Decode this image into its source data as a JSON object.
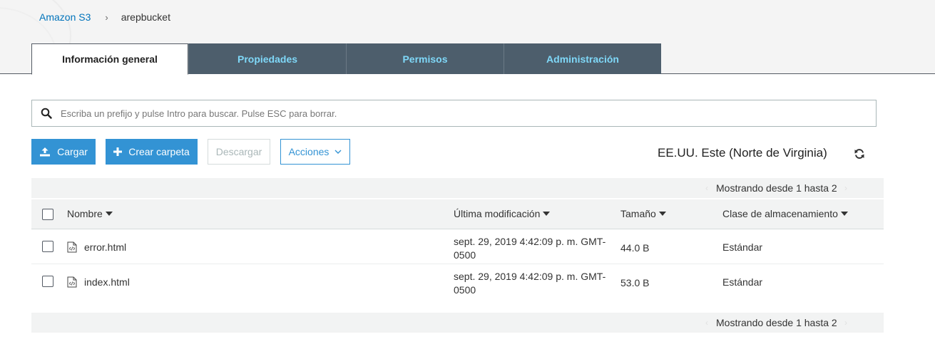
{
  "breadcrumb": {
    "root": "Amazon S3",
    "separator": "›",
    "current": "arepbucket"
  },
  "tabs": [
    {
      "label": "Información general",
      "active": true
    },
    {
      "label": "Propiedades",
      "active": false
    },
    {
      "label": "Permisos",
      "active": false
    },
    {
      "label": "Administración",
      "active": false
    }
  ],
  "search": {
    "placeholder": "Escriba un prefijo y pulse Intro para buscar. Pulse ESC para borrar.",
    "value": ""
  },
  "toolbar": {
    "upload": "Cargar",
    "create_folder": "Crear carpeta",
    "download": "Descargar",
    "actions": "Acciones"
  },
  "region": "EE.UU. Este (Norte de Virginia)",
  "pager": {
    "text": "Mostrando desde 1 hasta 2"
  },
  "table": {
    "headers": {
      "name": "Nombre",
      "modified": "Última modificación",
      "size": "Tamaño",
      "storage_class": "Clase de almacenamiento"
    },
    "rows": [
      {
        "name": "error.html",
        "modified": "sept. 29, 2019 4:42:09 p. m. GMT-0500",
        "size": "44.0 B",
        "storage_class": "Estándar"
      },
      {
        "name": "index.html",
        "modified": "sept. 29, 2019 4:42:09 p. m. GMT-0500",
        "size": "53.0 B",
        "storage_class": "Estándar"
      }
    ]
  },
  "colors": {
    "accent": "#3393d4",
    "tab_bg": "#4d5e6c",
    "tab_text": "#7fd8f8",
    "link": "#0073bb"
  }
}
